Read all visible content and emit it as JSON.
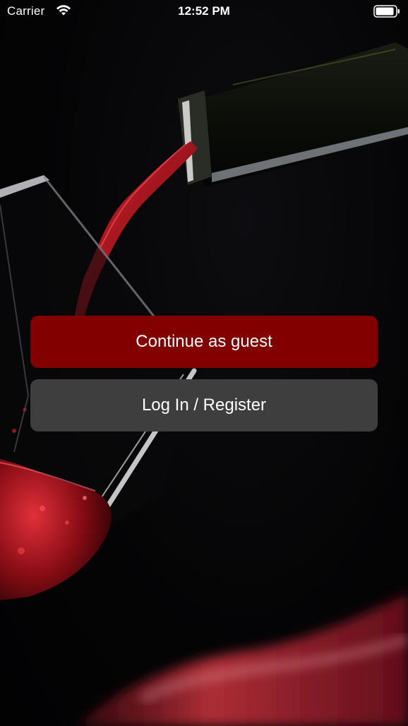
{
  "status_bar": {
    "carrier": "Carrier",
    "time": "12:52 PM",
    "wifi_icon": "wifi-icon",
    "battery_icon": "battery-icon"
  },
  "actions": {
    "guest_label": "Continue as guest",
    "login_label": "Log In / Register"
  },
  "colors": {
    "background": "#040405",
    "guest_button": "#830000",
    "login_button": "#3e3e3e",
    "text": "#ffffff",
    "wine": "#b3121c"
  }
}
